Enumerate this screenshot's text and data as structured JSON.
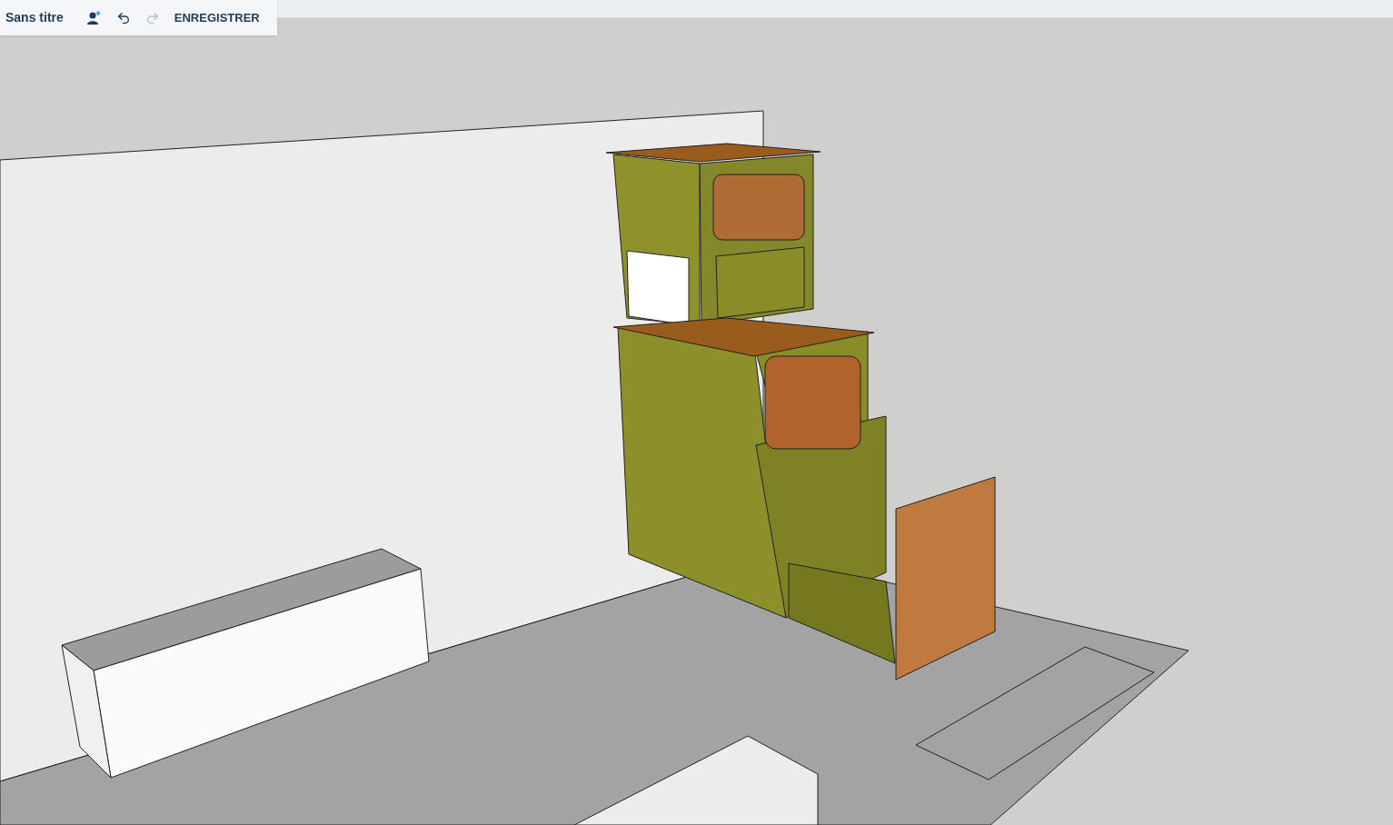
{
  "toolbar": {
    "title": "Sans titre",
    "undo": {
      "disabled": false
    },
    "redo": {
      "disabled": true
    },
    "save_button": "ENREGISTRER"
  }
}
